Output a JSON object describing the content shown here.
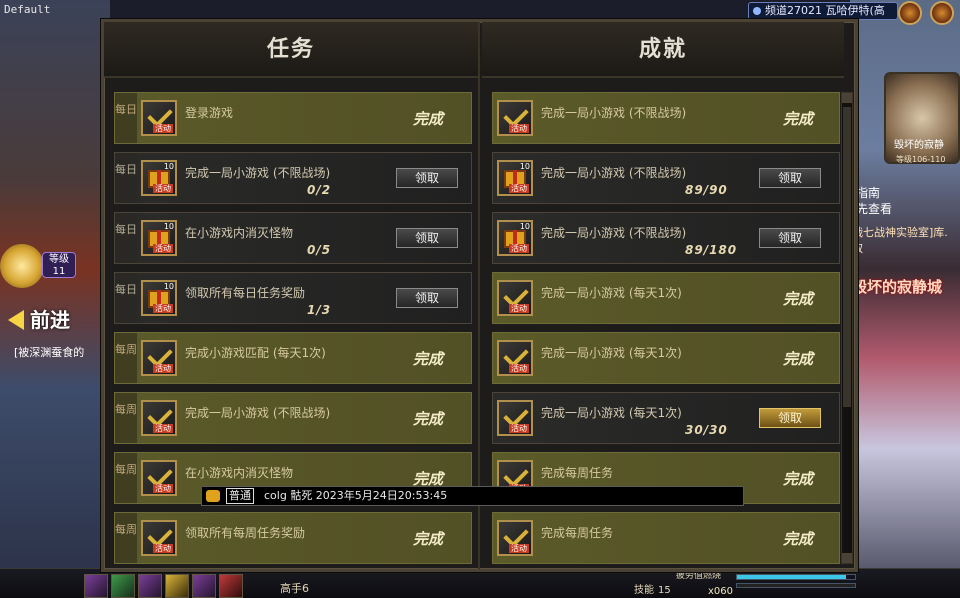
{
  "window": {
    "label": "Default"
  },
  "hud": {
    "channel": "频道27021 瓦哈伊特(高",
    "player_level_label": "等级",
    "player_level": "11",
    "forward_label": "前进",
    "quest_hint": "[被深渊蚕食的",
    "guide_line1": "指南",
    "guide_line2": "先查看",
    "item_line": "战七战神实验室]库.",
    "item_line2": "取",
    "city_name": "毁坏的寂静城",
    "dungeon_name": "毁坏的寂静",
    "dungeon_level": "等级106-110",
    "newbie_label": "高手6",
    "skill_label": "技能",
    "skill_points": "15",
    "fatigue_label": "疲劳值燃烧",
    "fatigue_fraction": 0.92,
    "multiplier": "x060"
  },
  "panel": {
    "close_label": "X",
    "tasks_header": "任务",
    "achievements_header": "成就",
    "claim_label": "领取",
    "done_label": "完成",
    "tasks": [
      {
        "period": "每日",
        "title": "登录游戏",
        "progress": "",
        "status": "done",
        "icon": "check-icon"
      },
      {
        "period": "每日",
        "title": "完成一局小游戏 (不限战场)",
        "progress": "0/2",
        "status": "claim",
        "icon": "gift-icon"
      },
      {
        "period": "每日",
        "title": "在小游戏内消灭怪物",
        "progress": "0/5",
        "status": "claim",
        "icon": "gift-icon"
      },
      {
        "period": "每日",
        "title": "领取所有每日任务奖励",
        "progress": "1/3",
        "status": "claim",
        "icon": "gift-icon"
      },
      {
        "period": "每周",
        "title": "完成小游戏匹配 (每天1次)",
        "progress": "",
        "status": "done",
        "icon": "check-icon"
      },
      {
        "period": "每周",
        "title": "完成一局小游戏 (不限战场)",
        "progress": "",
        "status": "done",
        "icon": "check-icon"
      },
      {
        "period": "每周",
        "title": "在小游戏内消灭怪物",
        "progress": "",
        "status": "done",
        "icon": "check-icon"
      },
      {
        "period": "每周",
        "title": "领取所有每周任务奖励",
        "progress": "",
        "status": "done",
        "icon": "check-icon"
      }
    ],
    "achievements": [
      {
        "title": "完成一局小游戏 (不限战场)",
        "progress": "",
        "status": "done",
        "icon": "check-icon"
      },
      {
        "title": "完成一局小游戏 (不限战场)",
        "progress": "89/90",
        "status": "claim",
        "icon": "gift-icon"
      },
      {
        "title": "完成一局小游戏 (不限战场)",
        "progress": "89/180",
        "status": "claim",
        "icon": "gift-icon"
      },
      {
        "title": "完成一局小游戏 (每天1次)",
        "progress": "",
        "status": "done",
        "icon": "check-icon"
      },
      {
        "title": "完成一局小游戏 (每天1次)",
        "progress": "",
        "status": "done",
        "icon": "check-icon"
      },
      {
        "title": "完成一局小游戏 (每天1次)",
        "progress": "30/30",
        "status": "claim-gold",
        "icon": "check-icon"
      },
      {
        "title": "完成每周任务",
        "progress": "",
        "status": "done",
        "icon": "check-icon"
      },
      {
        "title": "完成每周任务",
        "progress": "",
        "status": "done",
        "icon": "check-icon"
      }
    ],
    "icon_tag": "活动",
    "icon_num": "10"
  },
  "chat": {
    "channel": "普通",
    "message": "colg 骷死 2023年5月24日20:53:45"
  }
}
